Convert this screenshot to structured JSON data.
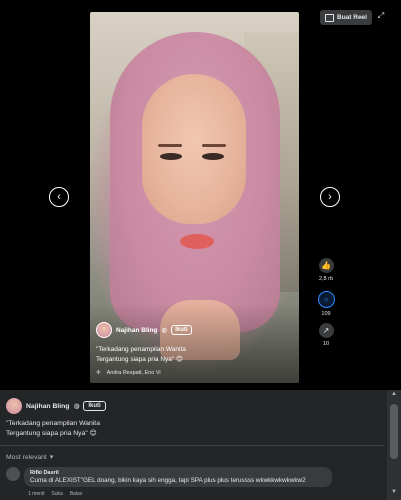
{
  "header": {
    "create_reel_label": "Buat Reel"
  },
  "overlay": {
    "author": "Najihan Bling",
    "follow_label": "Ikuti",
    "caption_line1": "\"Terkadang penampilan Wanita",
    "caption_line2": "Tergantung siapa pria Nya\" 😊",
    "audio": "Andra Respati, Eno Vi"
  },
  "actions": {
    "likes": "2,8 rb",
    "comments": "109",
    "shares": "10"
  },
  "post": {
    "author": "Najihan Bling",
    "follow_label": "Ikuti",
    "caption_line1": "\"Terkadang penampilan Wanita",
    "caption_line2": "Tergantung siapa pria Nya\" 😊"
  },
  "comments_sort_label": "Most relevant",
  "comment": {
    "name": "Rifki Dasril",
    "text": "Cuma di ALEXIST\"GEL doang, bikin kaya sih engga, tapi SPA plus plus terussss wkwkkwkwkwkw2",
    "time": "1 menit",
    "like_label": "Suka",
    "reply_label": "Balas"
  },
  "colors": {
    "accent": "#2d88ff",
    "panel": "#242526",
    "bubble": "#3a3b3c"
  }
}
